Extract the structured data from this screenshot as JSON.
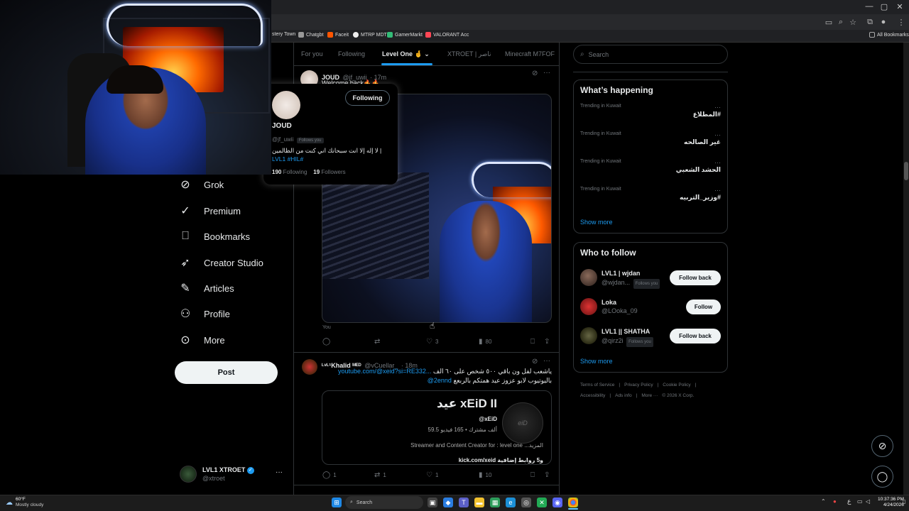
{
  "browser": {
    "bookmarks": [
      "stery Town",
      "Chatgbt",
      "Faceit",
      "MTRP MDT",
      "GamerMarkt",
      "VALORANT Acc"
    ],
    "all_bookmarks": "All Bookmarks"
  },
  "nav": {
    "items": [
      {
        "label": "Grok",
        "icon": "grok-icon"
      },
      {
        "label": "Premium",
        "icon": "verified-check-icon"
      },
      {
        "label": "Bookmarks",
        "icon": "bookmark-icon"
      },
      {
        "label": "Creator Studio",
        "icon": "rocket-icon"
      },
      {
        "label": "Articles",
        "icon": "article-icon"
      },
      {
        "label": "Profile",
        "icon": "person-icon"
      },
      {
        "label": "More",
        "icon": "more-circle-icon"
      }
    ],
    "post_label": "Post",
    "account": {
      "name": "LVL1 XTROET",
      "handle": "@xtroet",
      "more": "···"
    }
  },
  "tabs": [
    {
      "label": "For you"
    },
    {
      "label": "Following"
    },
    {
      "label": "Level One 🤞"
    },
    {
      "label": "XTROET | ناصر"
    },
    {
      "label": "Minecraft M7FOF"
    }
  ],
  "tweet1": {
    "name": "JOUD",
    "handle": "@jf_uwii",
    "time": "· 17m",
    "text": "Welcome back🔥🔥",
    "caption": "You",
    "replies": "",
    "retweets": "",
    "likes": "3",
    "views": "80"
  },
  "hovercard": {
    "name": "JOUD",
    "handle": "@jf_uwii",
    "follows_you": "Follows you",
    "follow_label": "Following",
    "bio_tags": "#LVL1 #HIL",
    "bio_text": "| لا إله إلا انت سبحانك اني كنت من الظالمين",
    "following_count": "190",
    "following_label": "Following",
    "followers_count": "19",
    "followers_label": "Followers"
  },
  "tweet2": {
    "name": "ᴸᵛᴸ¹Khalid ᴹᴱᴰ",
    "handle": "@vCuellar_",
    "time": "· 18m",
    "link": "youtube.com/@xeid?si=RE332...",
    "text_line1": "ياشعب لفل ون باقي ٥٠٠ شخص على ٦٠ الف",
    "text_line2": "باليوتيوب لابو عزوز عيد همتكم بالربعع",
    "mention": "@2ennd",
    "card": {
      "title": "عيد xEiD II",
      "channel": "@xEiD",
      "stats": "59.5 ألف مشترك • 165 فيديو",
      "desc": "Streamer and Content Creator for : level one ...المزيد",
      "links": "kick.com/xeid و5 روابط إضافية"
    },
    "replies": "1",
    "retweets": "1",
    "likes": "1",
    "views": "10"
  },
  "search": {
    "placeholder": "Search"
  },
  "whats_happening": {
    "title": "What’s happening",
    "trends": [
      {
        "meta": "Trending in Kuwait",
        "name": "#المطلاع"
      },
      {
        "meta": "Trending in Kuwait",
        "name": "غير الصالحه"
      },
      {
        "meta": "Trending in Kuwait",
        "name": "الحشد الشعبي"
      },
      {
        "meta": "Trending in Kuwait",
        "name": "#وزير_التربيه"
      }
    ],
    "show_more": "Show more"
  },
  "who_to_follow": {
    "title": "Who to follow",
    "users": [
      {
        "name": "LVL1 | wjdan",
        "handle": "@wjdan...",
        "badge": "Follows you",
        "button": "Follow back"
      },
      {
        "name": "Loka",
        "handle": "@LOoka_09",
        "badge": "",
        "button": "Follow"
      },
      {
        "name": "LVL1 || SHATHA",
        "handle": "@qirz2i",
        "badge": "Follows you",
        "button": "Follow back"
      }
    ],
    "show_more": "Show more"
  },
  "footer": {
    "links": [
      "Terms of Service",
      "|",
      "Privacy Policy",
      "|",
      "Cookie Policy",
      "|"
    ],
    "links2": [
      "Accessibility",
      "|",
      "Ads info",
      "|",
      "More ···",
      "© 2026 X Corp."
    ]
  },
  "taskbar": {
    "weather_temp": "60°F",
    "weather_text": "Mostly cloudy",
    "search_label": "Search",
    "lang": "ع",
    "time": "10:37:36 PM",
    "date": "4/24/2026"
  },
  "colors": {
    "accent": "#1d9bf0",
    "background": "#000000",
    "border": "#2f3336"
  }
}
